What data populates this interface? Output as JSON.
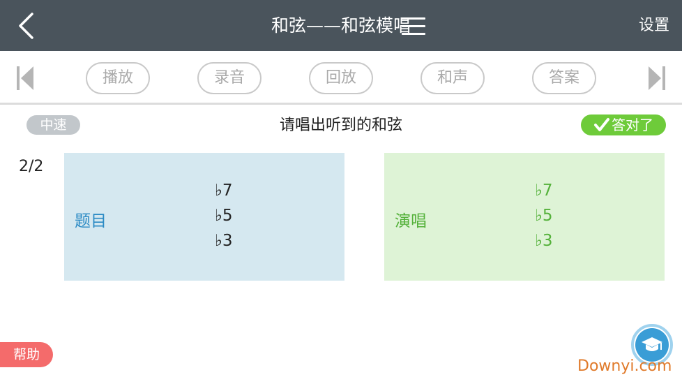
{
  "header": {
    "title": "和弦——和弦模唱",
    "settings_label": "设置",
    "bg_color": "#4a545c"
  },
  "toolbar": {
    "buttons": [
      {
        "label": "播放"
      },
      {
        "label": "录音"
      },
      {
        "label": "回放"
      },
      {
        "label": "和声"
      },
      {
        "label": "答案"
      }
    ]
  },
  "status": {
    "speed_label": "中速",
    "prompt": "请唱出听到的和弦",
    "result_label": "答对了",
    "result_color": "#6ecb3a"
  },
  "progress": {
    "counter": "2/2"
  },
  "question_card": {
    "label": "题目",
    "notes": [
      "♭7",
      "♭5",
      "♭3"
    ],
    "bg_color": "#d5e8f0"
  },
  "sing_card": {
    "label": "演唱",
    "notes": [
      "♭7",
      "♭5",
      "♭3"
    ],
    "bg_color": "#def3d6"
  },
  "footer": {
    "help_label": "帮助",
    "float_icon": "graduation-cap-icon",
    "watermark": "Downyi.com"
  }
}
